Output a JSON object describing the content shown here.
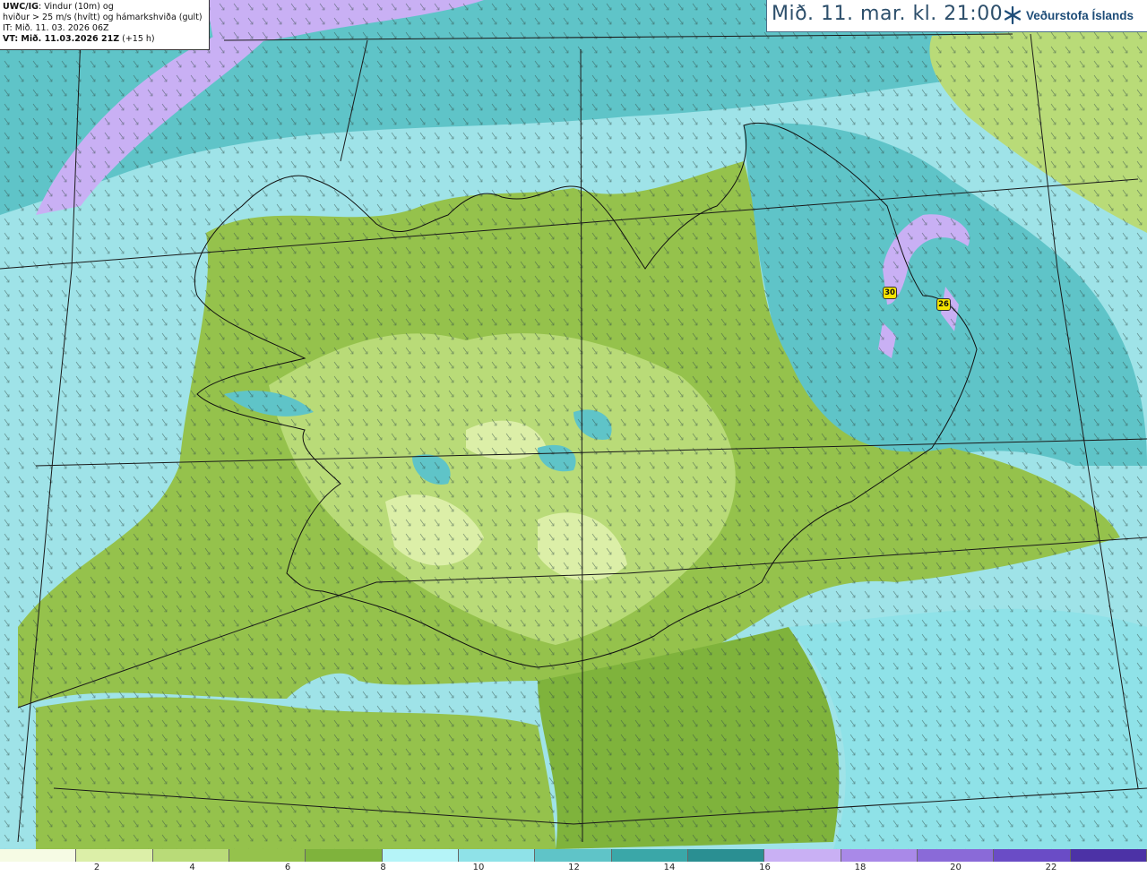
{
  "info": {
    "line1_bold": "UWC/IG",
    "line1_rest": ": Vindur (10m) og",
    "line2": "hviður > 25 m/s (hvítt) og hámarkshviða (gult)",
    "line3": "IT: Mið. 11. 03. 2026 06Z",
    "line4_bold": "VT: Mið. 11.03.2026 21Z",
    "line4_rest": " (+15 h)"
  },
  "date_title": "Mið. 11. mar. kl. 21:00",
  "logo_text": "Veðurstofa Íslands",
  "gust_badges": [
    "30",
    "26"
  ],
  "legend": {
    "colors": [
      "#f6fbe4",
      "#dcefa8",
      "#b9db78",
      "#95c24c",
      "#7fb33c",
      "#b5f4f8",
      "#8fe2e8",
      "#5fc4c8",
      "#3aa7a8",
      "#2a8f92",
      "#c9b0f4",
      "#a989e8",
      "#8a6ad8",
      "#6a4cc6",
      "#4c32a6"
    ],
    "ticks": [
      "2",
      "4",
      "6",
      "8",
      "10",
      "12",
      "14",
      "16",
      "18",
      "20",
      "22"
    ]
  }
}
